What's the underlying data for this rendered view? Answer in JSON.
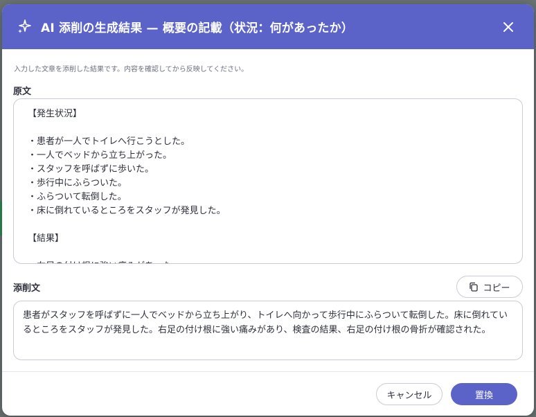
{
  "colors": {
    "header_bg": "#5b63c9",
    "primary_button": "#5b63c9",
    "border": "#c9ccd6"
  },
  "dialog": {
    "title": "AI 添削の生成結果 — 概要の記載（状況：何があったか）",
    "header_icon": "sparkle-icon",
    "close_icon": "close-icon",
    "instruction": "入力した文章を添削した結果です。内容を確認してから反映してください。"
  },
  "original": {
    "label": "原文",
    "text": "【発生状況】\n\n・患者が一人でトイレへ行こうとした。\n・一人でベッドから立ち上がった。\n・スタッフを呼ばずに歩いた。\n・歩行中にふらついた。\n・ふらついて転倒した。\n・床に倒れているところをスタッフが発見した。\n\n【結果】\n\n・右足の付け根に強い痛みがあった。"
  },
  "corrected": {
    "label": "添削文",
    "copy_label": "コピー",
    "copy_icon": "copy-icon",
    "text": "患者がスタッフを呼ばずに一人でベッドから立ち上がり、トイレへ向かって歩行中にふらついて転倒した。床に倒れているところをスタッフが発見した。右足の付け根に強い痛みがあり、検査の結果、右足の付け根の骨折が確認された。"
  },
  "footer": {
    "cancel_label": "キャンセル",
    "replace_label": "置換"
  }
}
